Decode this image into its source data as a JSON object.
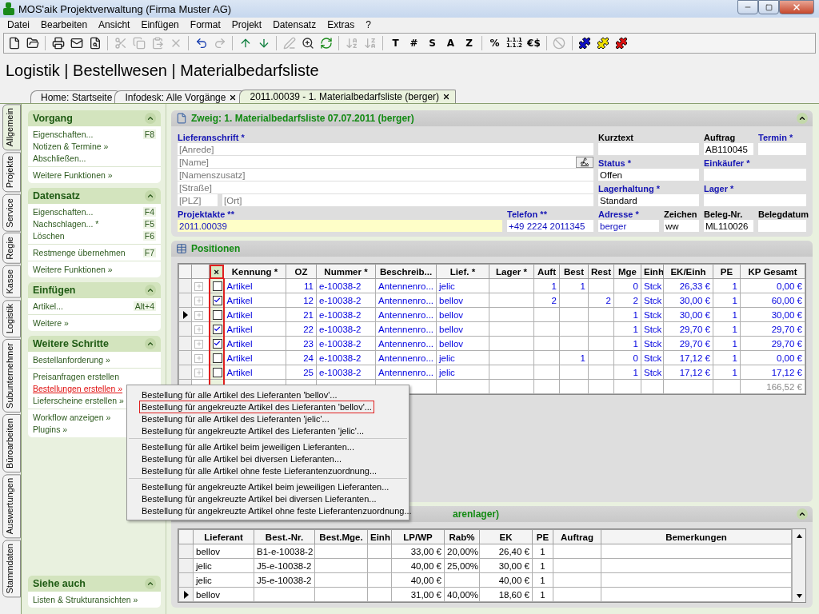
{
  "window": {
    "title": "MOS'aik Projektverwaltung (Firma Muster AG)"
  },
  "menu": [
    "Datei",
    "Bearbeiten",
    "Ansicht",
    "Einfügen",
    "Format",
    "Projekt",
    "Datensatz",
    "Extras",
    "?"
  ],
  "toolbar": [
    {
      "kind": "icon",
      "disabled": false
    },
    {
      "kind": "icon",
      "disabled": false
    },
    {
      "kind": "separator"
    },
    {
      "kind": "icon",
      "disabled": false
    },
    {
      "kind": "icon",
      "disabled": false
    },
    {
      "kind": "icon",
      "disabled": false
    },
    {
      "kind": "separator"
    },
    {
      "kind": "icon",
      "disabled": true
    },
    {
      "kind": "icon",
      "disabled": true
    },
    {
      "kind": "icon",
      "disabled": true
    },
    {
      "kind": "icon",
      "disabled": true
    },
    {
      "kind": "separator"
    },
    {
      "kind": "icon",
      "disabled": false
    },
    {
      "kind": "icon",
      "disabled": true
    },
    {
      "kind": "separator"
    },
    {
      "kind": "icon",
      "disabled": false
    },
    {
      "kind": "icon",
      "disabled": false
    },
    {
      "kind": "separator"
    },
    {
      "kind": "icon",
      "disabled": true
    },
    {
      "kind": "icon",
      "disabled": false
    },
    {
      "kind": "icon",
      "disabled": false
    },
    {
      "kind": "separator"
    },
    {
      "kind": "icon",
      "disabled": true
    },
    {
      "kind": "icon",
      "disabled": true
    },
    {
      "kind": "separator"
    },
    {
      "kind": "text",
      "label": "T"
    },
    {
      "kind": "text",
      "label": "#"
    },
    {
      "kind": "text",
      "label": "S"
    },
    {
      "kind": "text",
      "label": "A"
    },
    {
      "kind": "text",
      "label": "Z"
    },
    {
      "kind": "separator"
    },
    {
      "kind": "text",
      "label": "%"
    },
    {
      "kind": "text",
      "label": "1.1.1\n1.1.2"
    },
    {
      "kind": "text",
      "label": "€$"
    },
    {
      "kind": "separator"
    },
    {
      "kind": "icon",
      "disabled": true
    },
    {
      "kind": "separator"
    },
    {
      "kind": "puzzle",
      "color": "#1010c8"
    },
    {
      "kind": "puzzle",
      "color": "#f0e000"
    },
    {
      "kind": "puzzle",
      "color": "#e01010"
    }
  ],
  "heading": "Logistik | Bestellwesen | Materialbedarfsliste",
  "tabs": [
    {
      "label": "Home: Startseite",
      "closable": false,
      "selected": false
    },
    {
      "label": "Infodesk: Alle Vorgänge",
      "closable": true,
      "selected": false
    },
    {
      "label": "2011.00039 - 1. Materialbedarfsliste (berger)",
      "closable": true,
      "selected": true
    }
  ],
  "side_tabs": [
    {
      "label": "Allgemein",
      "selected": true
    },
    {
      "label": "Projekte",
      "selected": false
    },
    {
      "label": "Service",
      "selected": false
    },
    {
      "label": "Regie",
      "selected": false
    },
    {
      "label": "Kasse",
      "selected": false
    },
    {
      "label": "Logistik",
      "selected": false
    },
    {
      "label": "Subunternehmer",
      "selected": false
    },
    {
      "label": "Büroarbeiten",
      "selected": false
    },
    {
      "label": "Auswertungen",
      "selected": false
    },
    {
      "label": "Stammdaten",
      "selected": false
    }
  ],
  "sidebar": [
    {
      "title": "Vorgang",
      "groups": [
        [
          {
            "label": "Eigenschaften...",
            "shortcut": "F8",
            "highlighted": false
          },
          {
            "label": "Notizen & Termine »",
            "highlighted": false
          },
          {
            "label": "Abschließen...",
            "highlighted": false
          }
        ],
        [
          {
            "label": "Weitere Funktionen »",
            "highlighted": false
          }
        ]
      ]
    },
    {
      "title": "Datensatz",
      "groups": [
        [
          {
            "label": "Eigenschaften...",
            "shortcut": "F4",
            "highlighted": false
          },
          {
            "label": "Nachschlagen... *",
            "shortcut": "F5",
            "highlighted": false
          },
          {
            "label": "Löschen",
            "shortcut": "F6",
            "highlighted": false
          }
        ],
        [
          {
            "label": "Restmenge übernehmen",
            "shortcut": "F7",
            "highlighted": false
          }
        ],
        [
          {
            "label": "Weitere Funktionen »",
            "highlighted": false
          }
        ]
      ]
    },
    {
      "title": "Einfügen",
      "groups": [
        [
          {
            "label": "Artikel...",
            "shortcut": "Alt+4",
            "highlighted": false
          }
        ],
        [
          {
            "label": "Weitere »",
            "highlighted": false
          }
        ]
      ]
    },
    {
      "title": "Weitere Schritte",
      "groups": [
        [
          {
            "label": "Bestellanforderung »",
            "highlighted": false
          }
        ],
        [
          {
            "label": "Preisanfragen erstellen",
            "highlighted": false
          },
          {
            "label": "Bestellungen erstellen »",
            "highlighted": true
          },
          {
            "label": "Lieferscheine erstellen »",
            "highlighted": false
          }
        ],
        [
          {
            "label": "Workflow anzeigen »",
            "highlighted": false
          },
          {
            "label": "Plugins »",
            "highlighted": false
          }
        ]
      ]
    },
    {
      "title": "Siehe auch",
      "groups": [
        [
          {
            "label": "Listen & Strukturansichten »",
            "highlighted": false
          }
        ]
      ]
    }
  ],
  "branch": {
    "title": "Zweig: 1. Materialbedarfsliste 07.07.2011 (berger)",
    "address": {
      "label": "Lieferanschrift *",
      "required": true,
      "lines": [
        [
          {
            "placeholder": "[Anrede]",
            "button": false
          }
        ],
        [
          {
            "placeholder": "[Name]",
            "button": true
          }
        ],
        [
          {
            "placeholder": "[Namenszusatz]",
            "button": false
          }
        ],
        [
          {
            "placeholder": "[Straße]",
            "button": false
          }
        ],
        [
          {
            "placeholder": "[PLZ]",
            "button": false
          },
          {
            "placeholder": "[Ort]",
            "button": false
          }
        ]
      ]
    },
    "bottom": [
      {
        "label": "Projektakte **",
        "required": true,
        "kind": "marked",
        "value": "2011.00039"
      },
      {
        "label": "Telefon **",
        "required": true,
        "kind": "link",
        "value": "+49 2224 2011345"
      }
    ],
    "fields": [
      [
        {
          "label": "Kurztext",
          "required": false,
          "kind": "text"
        },
        {
          "label": "Auftrag",
          "required": false,
          "kind": "text",
          "value": "AB110045"
        },
        {
          "label": "Termin *",
          "required": true,
          "kind": "text"
        }
      ],
      [
        {
          "label": "Status *",
          "required": true,
          "kind": "text",
          "value": "Offen"
        },
        {
          "label": "Einkäufer *",
          "required": true,
          "kind": "text"
        }
      ],
      [
        {
          "label": "Lagerhaltung *",
          "required": true,
          "kind": "text",
          "value": "Standard"
        },
        {
          "label": "Lager *",
          "required": true,
          "kind": "text"
        }
      ],
      [
        {
          "label": "Adresse *",
          "required": true,
          "kind": "link",
          "value": "berger"
        },
        {
          "label": "Zeichen",
          "required": false,
          "kind": "text",
          "value": "ww"
        },
        {
          "label": "Beleg-Nr.",
          "required": false,
          "kind": "text",
          "value": "ML110026"
        },
        {
          "label": "Belegdatum",
          "required": false,
          "kind": "text"
        }
      ]
    ]
  },
  "positions": {
    "title": "Positionen",
    "check_column": {
      "label": "×",
      "highlighted": true
    },
    "columns": [
      "Kennung *",
      "OZ",
      "Nummer *",
      "Beschreib...",
      "Lief. *",
      "Lager *",
      "Auft",
      "Best",
      "Rest",
      "Mge",
      "Einh",
      "EK/Einh",
      "PE",
      "KP Gesamt"
    ],
    "rows": [
      {
        "current": false,
        "checked": false,
        "cells": [
          "Artikel",
          "11",
          "e-10038-2",
          "Antennenro...",
          "jelic",
          null,
          "1",
          "1",
          null,
          "0",
          "Stck",
          "26,33 €",
          "1",
          "0,00 €"
        ]
      },
      {
        "current": false,
        "checked": true,
        "cells": [
          "Artikel",
          "12",
          "e-10038-2",
          "Antennenro...",
          "bellov",
          null,
          "2",
          null,
          "2",
          "2",
          "Stck",
          "30,00 €",
          "1",
          "60,00 €"
        ]
      },
      {
        "current": true,
        "checked": false,
        "cells": [
          "Artikel",
          "21",
          "e-10038-2",
          "Antennenro...",
          "bellov",
          null,
          null,
          null,
          null,
          "1",
          "Stck",
          "30,00 €",
          "1",
          "30,00 €"
        ]
      },
      {
        "current": false,
        "checked": true,
        "cells": [
          "Artikel",
          "22",
          "e-10038-2",
          "Antennenro...",
          "bellov",
          null,
          null,
          null,
          null,
          "1",
          "Stck",
          "29,70 €",
          "1",
          "29,70 €"
        ]
      },
      {
        "current": false,
        "checked": true,
        "cells": [
          "Artikel",
          "23",
          "e-10038-2",
          "Antennenro...",
          "bellov",
          null,
          null,
          null,
          null,
          "1",
          "Stck",
          "29,70 €",
          "1",
          "29,70 €"
        ]
      },
      {
        "current": false,
        "checked": false,
        "cells": [
          "Artikel",
          "24",
          "e-10038-2",
          "Antennenro...",
          "jelic",
          null,
          null,
          "1",
          null,
          "0",
          "Stck",
          "17,12 €",
          "1",
          "0,00 €"
        ]
      },
      {
        "current": false,
        "checked": false,
        "cells": [
          "Artikel",
          "25",
          "e-10038-2",
          "Antennenro...",
          "jelic",
          null,
          null,
          null,
          null,
          "1",
          "Stck",
          "17,12 €",
          "1",
          "17,12 €"
        ]
      }
    ],
    "total": "166,52 €"
  },
  "suppliers": {
    "title": "arenlager)",
    "columns": [
      "Lieferant",
      "Best.-Nr.",
      "Best.Mge.",
      "Einh",
      "LP/WP",
      "Rab%",
      "EK",
      "PE",
      "Auftrag",
      "Bemerkungen"
    ],
    "rows": [
      {
        "current": false,
        "cells": [
          "bellov",
          "B1-e-10038-2",
          null,
          null,
          "33,00 €",
          "20,00%",
          "26,40 €",
          "1",
          null,
          null
        ]
      },
      {
        "current": false,
        "cells": [
          "jelic",
          "J5-e-10038-2",
          null,
          null,
          "40,00 €",
          "25,00%",
          "30,00 €",
          "1",
          null,
          null
        ]
      },
      {
        "current": false,
        "cells": [
          "jelic",
          "J5-e-10038-2",
          null,
          null,
          "40,00 €",
          null,
          "40,00 €",
          "1",
          null,
          null
        ]
      },
      {
        "current": true,
        "cells": [
          "bellov",
          null,
          null,
          null,
          "31,00 €",
          "40,00%",
          "18,60 €",
          "1",
          null,
          null
        ]
      }
    ]
  },
  "context_menu": {
    "groups": [
      [
        {
          "label": "Bestellung für alle Artikel des Lieferanten 'bellov'...",
          "selected": false
        },
        {
          "label": "Bestellung für angekreuzte Artikel des Lieferanten 'bellov'...",
          "selected": true
        },
        {
          "label": "Bestellung für alle Artikel des Lieferanten 'jelic'...",
          "selected": false
        },
        {
          "label": "Bestellung für angekreuzte Artikel des Lieferanten 'jelic'...",
          "selected": false
        }
      ],
      [
        {
          "label": "Bestellung für alle Artikel beim jeweiligen Lieferanten...",
          "selected": false
        },
        {
          "label": "Bestellung für alle Artikel bei diversen Lieferanten...",
          "selected": false
        },
        {
          "label": "Bestellung für alle Artikel ohne feste Lieferantenzuordnung...",
          "selected": false
        }
      ],
      [
        {
          "label": "Bestellung für angekreuzte Artikel beim jeweiligen Lieferanten...",
          "selected": false
        },
        {
          "label": "Bestellung für angekreuzte Artikel bei diversen Lieferanten...",
          "selected": false
        },
        {
          "label": "Bestellung für angekreuzte Artikel ohne feste Lieferantenzuordnung...",
          "selected": false
        }
      ]
    ]
  }
}
